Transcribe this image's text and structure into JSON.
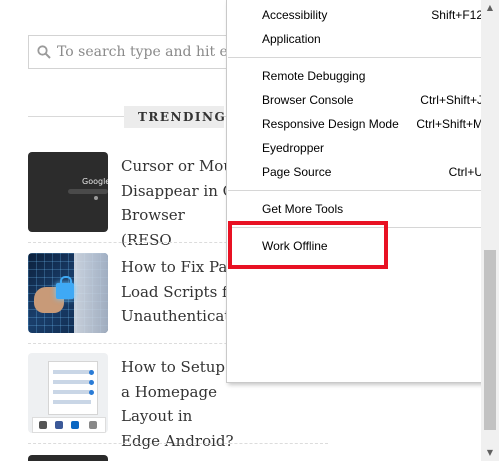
{
  "search": {
    "placeholder": "To search type and hit ent"
  },
  "trending": {
    "label": "TRENDING"
  },
  "articles": [
    {
      "title": "Cursor or Mou Disappear in C Browser (RESO",
      "thumb_text": "Google"
    },
    {
      "title": "How to Fix Pa Load Scripts fr Unauthenticate"
    },
    {
      "title": "How to Setup a Homepage Layout in Edge Android?"
    }
  ],
  "menu": {
    "items": [
      {
        "label": "Accessibility",
        "shortcut": "Shift+F12"
      },
      {
        "label": "Application",
        "shortcut": ""
      },
      {
        "label": "Remote Debugging",
        "shortcut": ""
      },
      {
        "label": "Browser Console",
        "shortcut": "Ctrl+Shift+J"
      },
      {
        "label": "Responsive Design Mode",
        "shortcut": "Ctrl+Shift+M"
      },
      {
        "label": "Eyedropper",
        "shortcut": ""
      },
      {
        "label": "Page Source",
        "shortcut": "Ctrl+U"
      },
      {
        "label": "Get More Tools",
        "shortcut": ""
      },
      {
        "label": "Work Offline",
        "shortcut": ""
      }
    ]
  },
  "colors": {
    "highlight": "#e81123",
    "menu_bg": "#ffffff",
    "text": "#333333"
  },
  "icons": {
    "search": "search-icon"
  }
}
